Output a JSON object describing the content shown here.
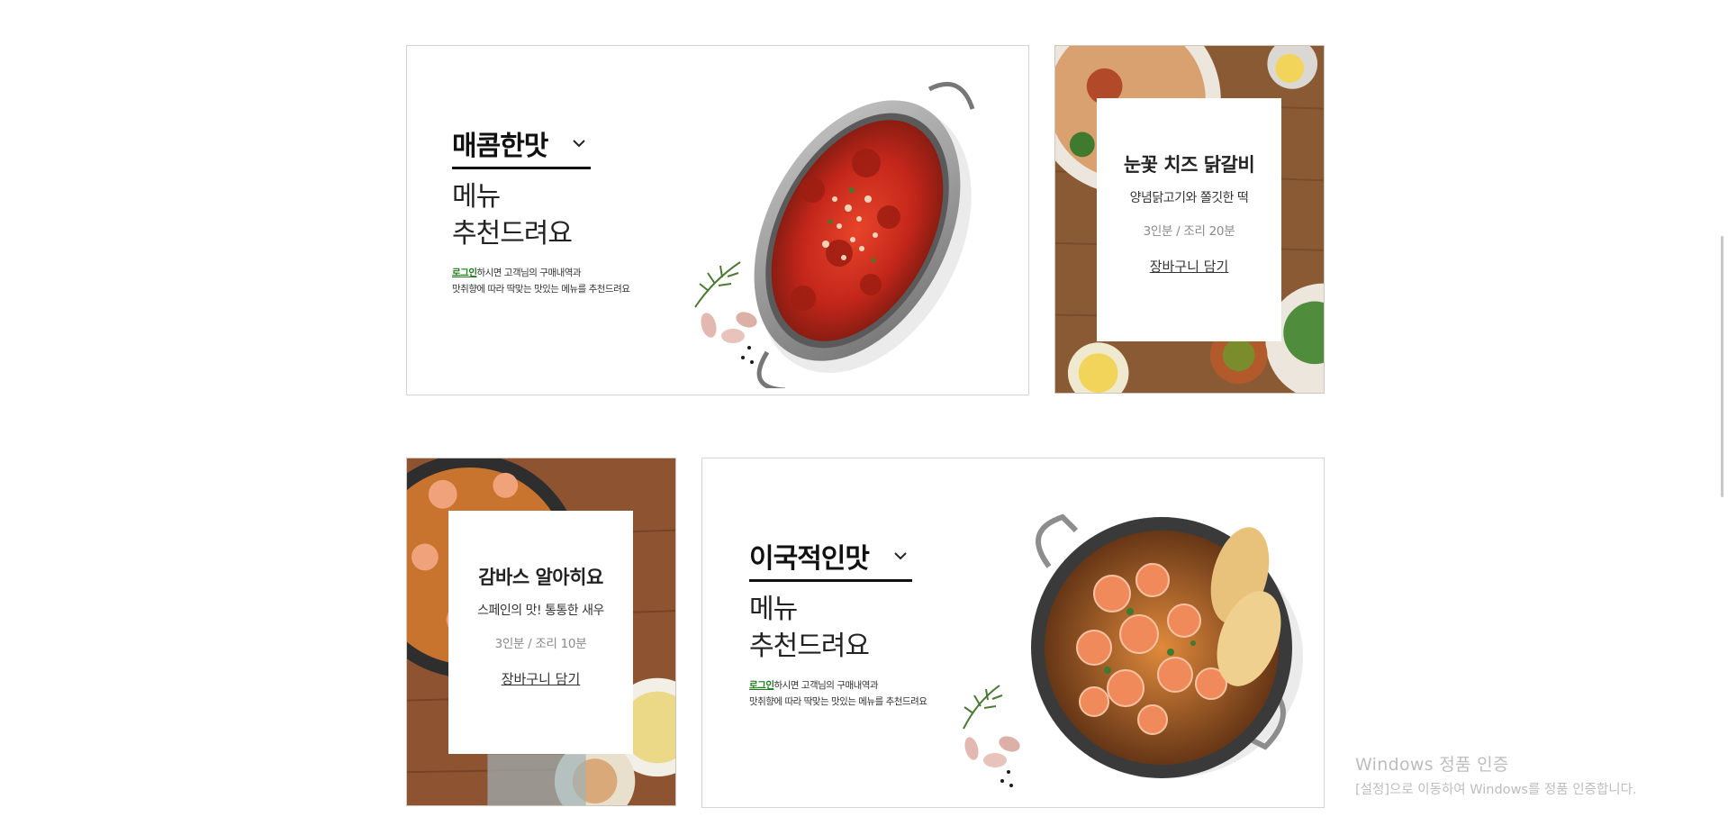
{
  "banners": [
    {
      "taste": "매콤한맛",
      "headline_1": "메뉴",
      "headline_2": "추천드려요",
      "login_link": "로그인",
      "desc_1_rest": "하시면 고객님의 구매내역과",
      "desc_2": "맛취향에 따라 딱맞는 맛있는 메뉴를 추천드려요",
      "dish": "spicy-chicken-pan"
    },
    {
      "taste": "이국적인맛",
      "headline_1": "메뉴",
      "headline_2": "추천드려요",
      "login_link": "로그인",
      "desc_1_rest": "하시면 고객님의 구매내역과",
      "desc_2": "맛취향에 따라 딱맞는 맛있는 메뉴를 추천드려요",
      "dish": "garlic-shrimp-pan"
    }
  ],
  "recipe_cards": [
    {
      "title": "눈꽃 치즈 닭갈비",
      "subtitle": "양념닭고기와 쫄깃한 떡",
      "meta": "3인분 / 조리 20분",
      "cart_label": "장바구니 담기"
    },
    {
      "title": "감바스 알아히요",
      "subtitle": "스페인의 맛! 통통한 새우",
      "meta": "3인분 / 조리 10분",
      "cart_label": "장바구니 담기"
    }
  ],
  "icons": [
    "chevron-down-icon",
    "rosemary-garnish",
    "garlic-clove"
  ],
  "colors": {
    "login_link": "#1f7a1f",
    "border": "#d4d4d4",
    "wood": "#8a5a34"
  },
  "watermark": {
    "title": "Windows 정품 인증",
    "subtitle": "[설정]으로 이동하여 Windows를 정품 인증합니다."
  }
}
